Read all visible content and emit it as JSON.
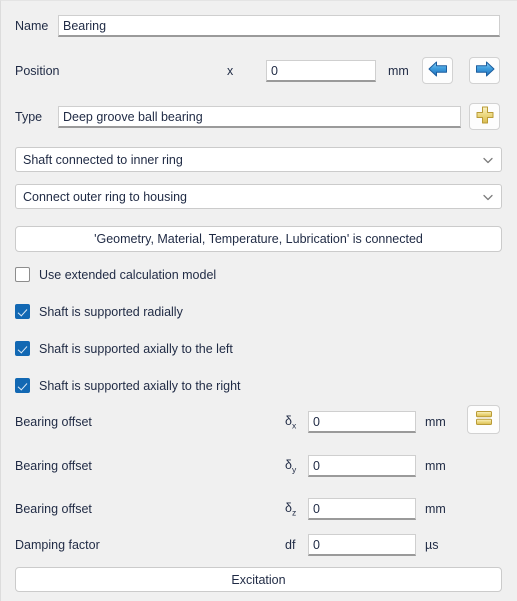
{
  "form": {
    "name": {
      "label": "Name",
      "value": "Bearing"
    },
    "position": {
      "label": "Position",
      "axis": "x",
      "value": "0",
      "unit": "mm",
      "prev_icon": "arrow-left-icon",
      "next_icon": "arrow-right-icon"
    },
    "type": {
      "label": "Type",
      "value": "Deep groove ball bearing",
      "add_icon": "plus-icon"
    },
    "inner_ring_combo": {
      "value": "Shaft connected to inner ring",
      "chevron_icon": "chevron-down-icon"
    },
    "outer_ring_combo": {
      "value": "Connect outer ring to housing",
      "chevron_icon": "chevron-down-icon"
    },
    "connected_button": {
      "label": "'Geometry, Material, Temperature, Lubrication' is connected"
    },
    "checkboxes": [
      {
        "label": "Use extended calculation model",
        "checked": false
      },
      {
        "label": "Shaft is supported radially",
        "checked": true
      },
      {
        "label": "Shaft is supported axially to the left",
        "checked": true
      },
      {
        "label": "Shaft is supported axially to the right",
        "checked": true
      }
    ],
    "offsets": [
      {
        "label": "Bearing offset",
        "symbol": "δ",
        "subscript": "x",
        "value": "0",
        "unit": "mm"
      },
      {
        "label": "Bearing offset",
        "symbol": "δ",
        "subscript": "y",
        "value": "0",
        "unit": "mm"
      },
      {
        "label": "Bearing offset",
        "symbol": "δ",
        "subscript": "z",
        "value": "0",
        "unit": "mm"
      }
    ],
    "damping": {
      "label": "Damping factor",
      "symbol": "df",
      "value": "0",
      "unit": "µs"
    },
    "table_button": {
      "icon": "table-rows-icon"
    },
    "excitation_button": {
      "label": "Excitation"
    }
  },
  "colors": {
    "background": "#f0f0f0",
    "checkbox_checked": "#1268b3",
    "arrow_blue": "#2f8ed6",
    "icon_yellow": "#e8d27a",
    "text": "#1f2a44"
  }
}
